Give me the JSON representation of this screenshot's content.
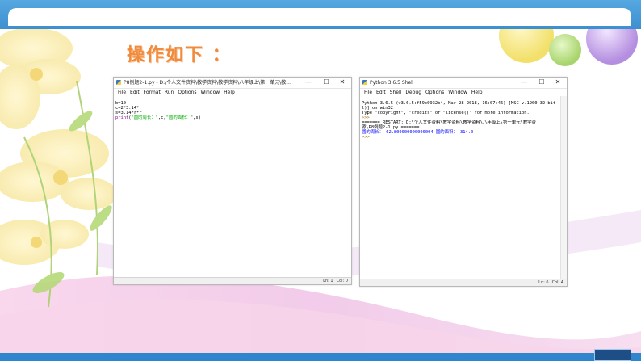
{
  "slide": {
    "title": "操作如下 ："
  },
  "editor_window": {
    "title": "P8例题2-1.py - D:\\个人文件资料\\教学资料\\教学资料\\八年级上\\第一单元\\教...",
    "menu": [
      "File",
      "Edit",
      "Format",
      "Run",
      "Options",
      "Window",
      "Help"
    ],
    "code": {
      "l1": "b=10",
      "l2": "c=2*3.14*r",
      "l3": "s=3.14*r*r",
      "l4_kw": "print",
      "l4_a": "(",
      "l4_s1": "\"圆的周长：\"",
      "l4_b": ",c,",
      "l4_s2": "\"圆的面积：\"",
      "l4_c": ",s)"
    },
    "status": {
      "line": "Ln: 1",
      "col": "Col: 0"
    }
  },
  "shell_window": {
    "title": "Python 3.6.5 Shell",
    "menu": [
      "File",
      "Edit",
      "Shell",
      "Debug",
      "Options",
      "Window",
      "Help"
    ],
    "lines": {
      "l1": "Python 3.6.5 (v3.6.5:f59c0932b4, Mar 28 2018, 16:07:46) [MSC v.1900 32 bit (Inte",
      "l2": "l)] on win32",
      "l3": "Type \"copyright\", \"credits\" or \"license()\" for more information.",
      "l4": ">>> ",
      "l5": "======= RESTART: D:\\个人文件资料\\教学资料\\教学资料\\八年级上\\第一单元\\教学资",
      "l6": "源\\P8例题2-1.py =======",
      "l7": "圆的周长： 62.800000000000004 圆的面积： 314.0",
      "l8": ">>> "
    },
    "status": {
      "line": "Ln: 6",
      "col": "Col: 4"
    }
  },
  "window_controls": {
    "minimize": "—",
    "maximize": "☐",
    "close": "✕"
  }
}
